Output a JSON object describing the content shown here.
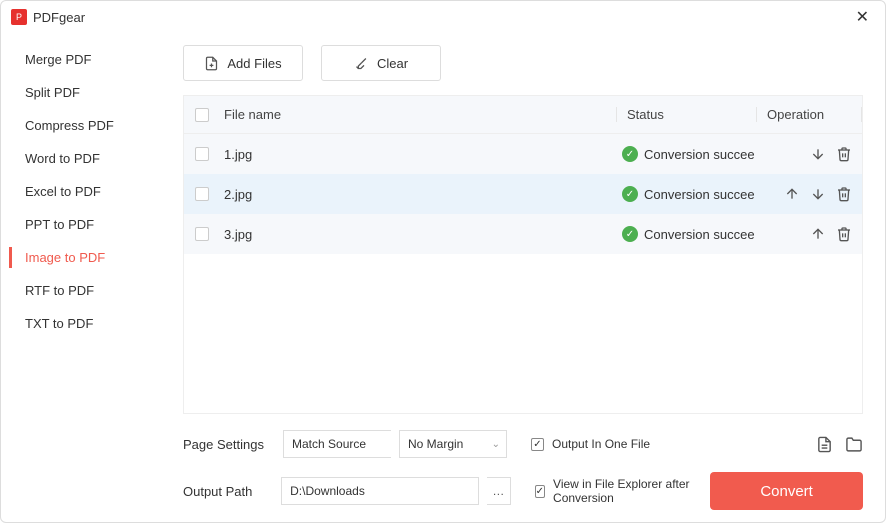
{
  "app": {
    "title": "PDFgear"
  },
  "sidebar": {
    "items": [
      {
        "label": "Merge PDF"
      },
      {
        "label": "Split PDF"
      },
      {
        "label": "Compress PDF"
      },
      {
        "label": "Word to PDF"
      },
      {
        "label": "Excel to PDF"
      },
      {
        "label": "PPT to PDF"
      },
      {
        "label": "Image to PDF"
      },
      {
        "label": "RTF to PDF"
      },
      {
        "label": "TXT to PDF"
      }
    ],
    "active_index": 6
  },
  "toolbar": {
    "add_files": "Add Files",
    "clear": "Clear"
  },
  "table": {
    "headers": {
      "filename": "File name",
      "status": "Status",
      "operation": "Operation"
    },
    "rows": [
      {
        "name": "1.jpg",
        "status": "Conversion succee",
        "ops": [
          "down",
          "delete"
        ]
      },
      {
        "name": "2.jpg",
        "status": "Conversion succee",
        "ops": [
          "up",
          "down",
          "delete"
        ]
      },
      {
        "name": "3.jpg",
        "status": "Conversion succee",
        "ops": [
          "up",
          "delete"
        ]
      }
    ],
    "selected_index": 1
  },
  "footer": {
    "page_settings_label": "Page Settings",
    "match_source": "Match Source",
    "no_margin": "No Margin",
    "output_one_file": "Output In One File",
    "output_path_label": "Output Path",
    "output_path_value": "D:\\Downloads",
    "view_in_explorer": "View in File Explorer after Conversion",
    "convert": "Convert"
  }
}
